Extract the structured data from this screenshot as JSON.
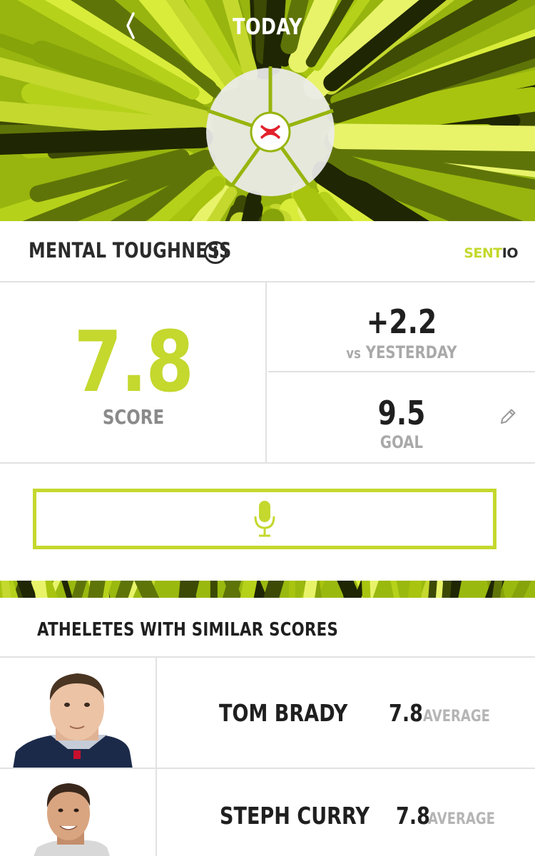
{
  "header": {
    "title": "TODAY",
    "back_icon": "chevron-left-icon",
    "accent_color": "#c4d82e",
    "hero_color": "#97b50e"
  },
  "metric": {
    "title": "MENTAL TOUGHNESS",
    "info_icon": "info-icon",
    "brand_prefix": "SENT",
    "brand_suffix": "IO"
  },
  "stats": {
    "score": "7.8",
    "score_label": "SCORE",
    "delta": "+2.2",
    "delta_vs": "vs",
    "delta_label": "YESTERDAY",
    "goal": "9.5",
    "goal_label": "GOAL",
    "edit_icon": "pencil-icon"
  },
  "record": {
    "icon": "microphone-icon"
  },
  "similar": {
    "title": "ATHELETES WITH SIMILAR SCORES",
    "athletes": [
      {
        "name": "TOM BRADY",
        "score": "7.8",
        "label": "AVERAGE"
      },
      {
        "name": "STEPH CURRY",
        "score": "7.8",
        "label": "AVERAGE"
      }
    ]
  }
}
